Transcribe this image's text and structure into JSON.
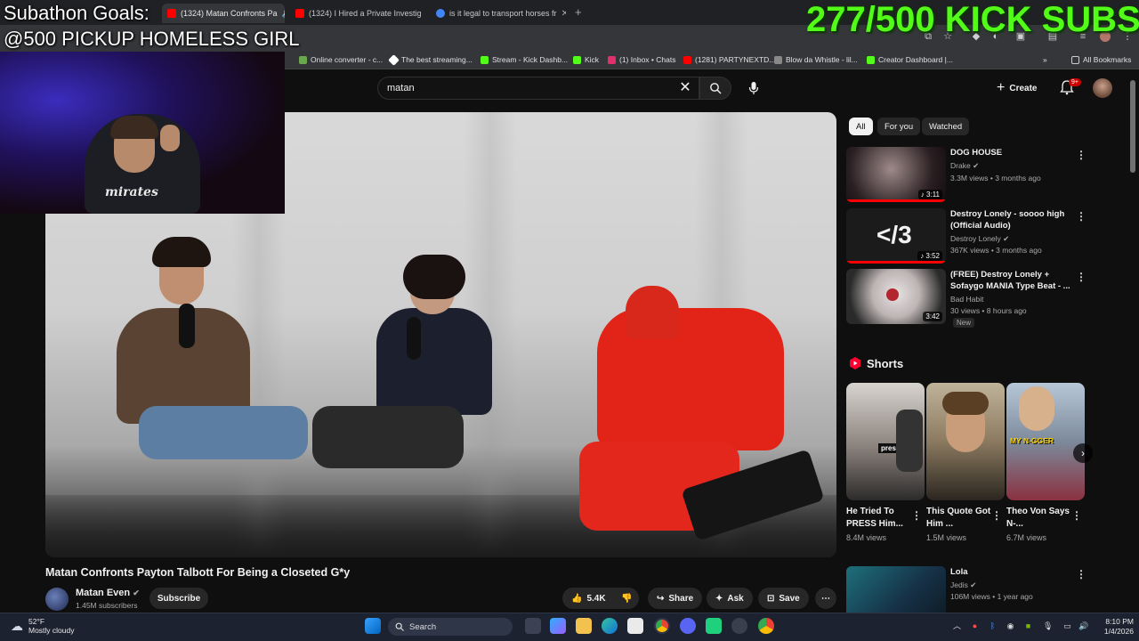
{
  "browser": {
    "tabs": [
      {
        "title": "(1324) Matan Confronts Pa",
        "active": true,
        "color": "#ff0000"
      },
      {
        "title": "(1324) I Hired a Private Investig",
        "active": false,
        "color": "#ff0000"
      },
      {
        "title": "is it legal to transport horses fr",
        "active": false,
        "color": "#4285f4"
      }
    ],
    "profile_label": "Gemini",
    "bookmarks": [
      {
        "label": "Online converter - c...",
        "color": "#6aa84f"
      },
      {
        "label": "The best streaming...",
        "color": "#ffffff"
      },
      {
        "label": "Stream - Kick Dashb...",
        "color": "#53fc18"
      },
      {
        "label": "Kick",
        "color": "#53fc18"
      },
      {
        "label": "(1) Inbox • Chats",
        "color": "#e1306c"
      },
      {
        "label": "(1281) PARTYNEXTD...",
        "color": "#ff0000"
      },
      {
        "label": "Blow da Whistle - lil...",
        "color": "#888888"
      },
      {
        "label": "Creator Dashboard |...",
        "color": "#53fc18"
      }
    ],
    "all_bookmarks": "All Bookmarks"
  },
  "stream_overlay": {
    "title": "Subathon Goals:",
    "goal": "@500 PICKUP HOMELESS GIRL",
    "kick_subs": "277/500 KICK SUBS",
    "webcam_shirt": "mirates"
  },
  "youtube": {
    "search": {
      "value": "matan"
    },
    "create_label": "Create",
    "notification_count": "9+",
    "video": {
      "title": "Matan Confronts Payton Talbott For Being a Closeted G*y",
      "channel": "Matan Even",
      "subscribers": "1.45M subscribers",
      "subscribe_label": "Subscribe",
      "likes": "5.4K",
      "share_label": "Share",
      "ask_label": "Ask",
      "save_label": "Save"
    },
    "filter_chips": [
      "All",
      "For you",
      "Watched"
    ],
    "recommendations": [
      {
        "title": "DOG HOUSE",
        "channel": "Drake",
        "meta": "3.3M views • 3 months ago",
        "duration": "3:11",
        "new": ""
      },
      {
        "title": "Destroy Lonely - soooo high (Official Audio)",
        "channel": "Destroy Lonely",
        "meta": "367K views • 3 months ago",
        "duration": "3:52",
        "new": "",
        "thumb_text": "</3"
      },
      {
        "title": "(FREE) Destroy Lonely + Sofaygo MANIA Type  Beat - ...",
        "channel": "Bad Habit",
        "meta": "30 views • 8 hours ago",
        "duration": "3:42",
        "new": "New"
      }
    ],
    "shorts_label": "Shorts",
    "shorts": [
      {
        "title": "He Tried To PRESS Him...",
        "views": "8.4M views",
        "thumb_text": "press"
      },
      {
        "title": "This Quote Got Him ...",
        "views": "1.5M views",
        "thumb_text": ""
      },
      {
        "title": "Theo Von Says N-...",
        "views": "6.7M views",
        "thumb_text": "MY N-GGER"
      }
    ],
    "next_rec": {
      "title": "Lola",
      "channel": "Jedis",
      "meta": "106M views • 1 year ago"
    }
  },
  "taskbar": {
    "temperature": "52°F",
    "weather": "Mostly cloudy",
    "search_label": "Search",
    "time": "8:10 PM",
    "date": "1/4/2026"
  }
}
